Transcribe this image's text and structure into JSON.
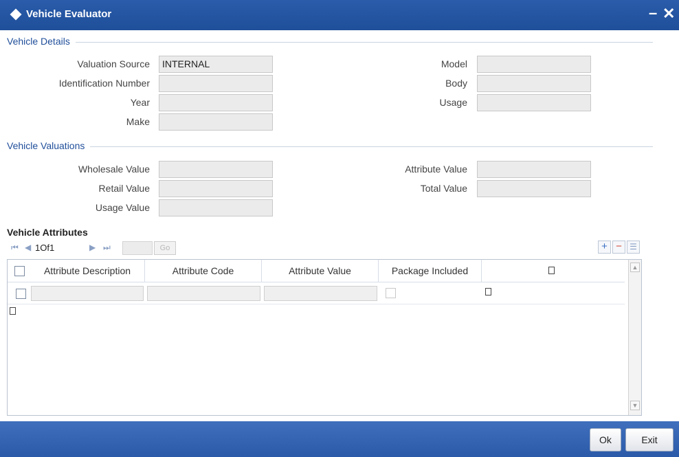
{
  "window": {
    "title": "Vehicle Evaluator",
    "min_glyph": "–",
    "close_glyph": "✕"
  },
  "sections": {
    "details": "Vehicle Details",
    "valuations": "Vehicle Valuations",
    "attributes": "Vehicle Attributes"
  },
  "details": {
    "valuation_source": {
      "label": "Valuation Source",
      "value": "INTERNAL"
    },
    "identification_number": {
      "label": "Identification Number",
      "value": ""
    },
    "year": {
      "label": "Year",
      "value": ""
    },
    "make": {
      "label": "Make",
      "value": ""
    },
    "model": {
      "label": "Model",
      "value": ""
    },
    "body": {
      "label": "Body",
      "value": ""
    },
    "usage": {
      "label": "Usage",
      "value": ""
    }
  },
  "valuations": {
    "wholesale_value": {
      "label": "Wholesale Value",
      "value": ""
    },
    "retail_value": {
      "label": "Retail Value",
      "value": ""
    },
    "usage_value": {
      "label": "Usage Value",
      "value": ""
    },
    "attribute_value": {
      "label": "Attribute Value",
      "value": ""
    },
    "total_value": {
      "label": "Total Value",
      "value": ""
    }
  },
  "pager": {
    "text": "1Of1",
    "go_label": "Go",
    "first_glyph": "⏮",
    "prev_glyph": "◀",
    "next_glyph": "▶",
    "last_glyph": "⏭",
    "add_glyph": "+",
    "remove_glyph": "−",
    "view_glyph": "☰"
  },
  "grid": {
    "columns": [
      "Attribute Description",
      "Attribute Code",
      "Attribute Value",
      "Package Included"
    ]
  },
  "buttons": {
    "ok": "Ok",
    "exit": "Exit"
  },
  "colors": {
    "title_bar": "#1f4f99",
    "section_heading": "#1f4e9a",
    "footer": "#2b5aa8"
  }
}
